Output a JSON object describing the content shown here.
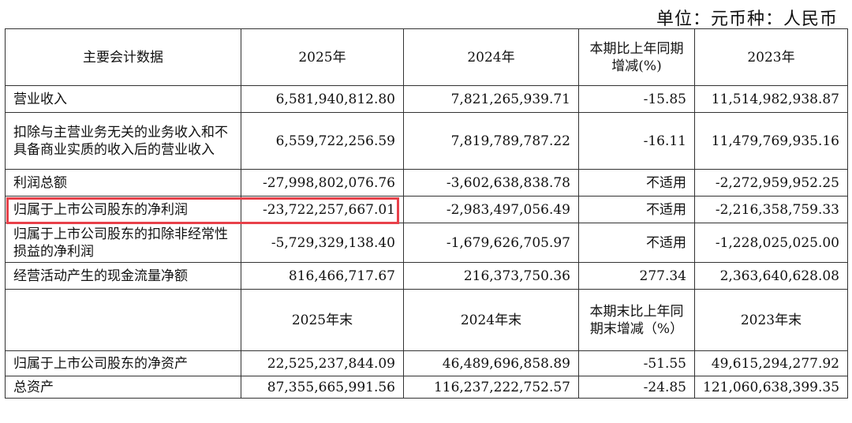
{
  "unit_note": "单位：元币种：人民币",
  "header1": {
    "col1": "主要会计数据",
    "col2": "2025年",
    "col3": "2024年",
    "col4": "本期比上年同期增减(%)",
    "col5": "2023年"
  },
  "rows1": [
    {
      "label": "营业收入",
      "v2025": "6,581,940,812.80",
      "v2024": "7,821,265,939.71",
      "change": "-15.85",
      "v2023": "11,514,982,938.87"
    },
    {
      "label": "扣除与主营业务无关的业务收入和不具备商业实质的收入后的营业收入",
      "v2025": "6,559,722,256.59",
      "v2024": "7,819,789,787.22",
      "change": "-16.11",
      "v2023": "11,479,769,935.16"
    },
    {
      "label": "利润总额",
      "v2025": "-27,998,802,076.76",
      "v2024": "-3,602,638,838.78",
      "change": "不适用",
      "v2023": "-2,272,959,952.25"
    },
    {
      "label": "归属于上市公司股东的净利润",
      "v2025": "-23,722,257,667.01",
      "v2024": "-2,983,497,056.49",
      "change": "不适用",
      "v2023": "-2,216,358,759.33"
    },
    {
      "label": "归属于上市公司股东的扣除非经常性损益的净利润",
      "v2025": "-5,729,329,138.40",
      "v2024": "-1,679,626,705.97",
      "change": "不适用",
      "v2023": "-1,228,025,025.00"
    },
    {
      "label": "经营活动产生的现金流量净额",
      "v2025": "816,466,717.67",
      "v2024": "216,373,750.36",
      "change": "277.34",
      "v2023": "2,363,640,628.08"
    }
  ],
  "header2": {
    "col1": "",
    "col2": "2025年末",
    "col3": "2024年末",
    "col4": "本期末比上年同期末增减（%）",
    "col5": "2023年末"
  },
  "rows2": [
    {
      "label": "归属于上市公司股东的净资产",
      "v2025": "22,525,237,844.09",
      "v2024": "46,489,696,858.89",
      "change": "-51.55",
      "v2023": "49,615,294,277.92"
    },
    {
      "label": "总资产",
      "v2025": "87,355,665,991.56",
      "v2024": "116,237,222,752.57",
      "change": "-24.85",
      "v2023": "121,060,638,399.35"
    }
  ],
  "highlight": {
    "color": "#e8414a",
    "target": "归属于上市公司股东的净利润"
  }
}
